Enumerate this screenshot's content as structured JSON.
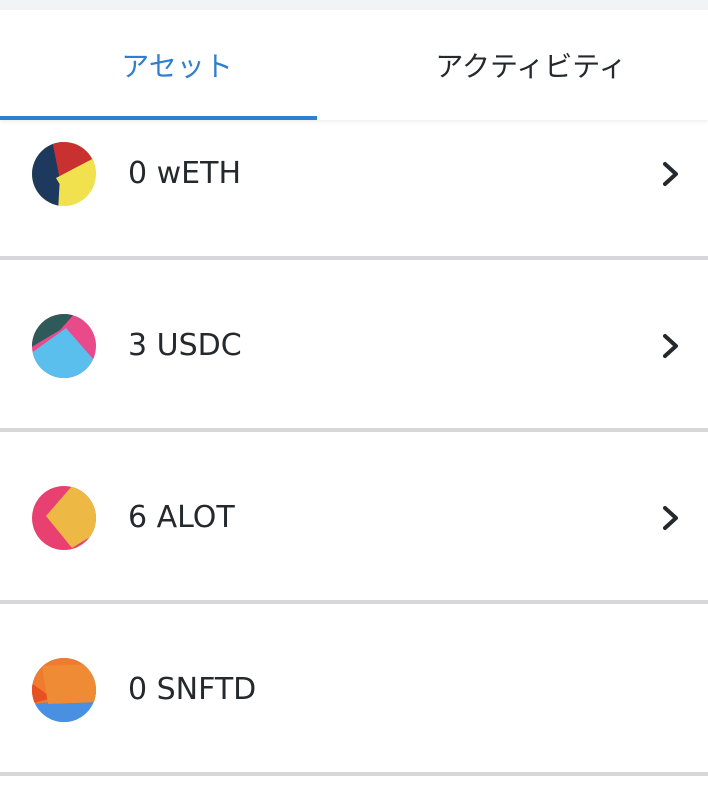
{
  "tabs": [
    {
      "label": "アセット",
      "active": true
    },
    {
      "label": "アクティビティ",
      "active": false
    }
  ],
  "assets": [
    {
      "label": "0 wETH",
      "icon": "weth-token-icon",
      "has_chevron": true
    },
    {
      "label": "3 USDC",
      "icon": "usdc-token-icon",
      "has_chevron": true
    },
    {
      "label": "6 ALOT",
      "icon": "alot-token-icon",
      "has_chevron": true
    },
    {
      "label": "0 SNFTD",
      "icon": "snftd-token-icon",
      "has_chevron": false
    }
  ],
  "colors": {
    "accent": "#2f7fd1",
    "text": "#24292e",
    "divider": "#d6d7d8"
  }
}
